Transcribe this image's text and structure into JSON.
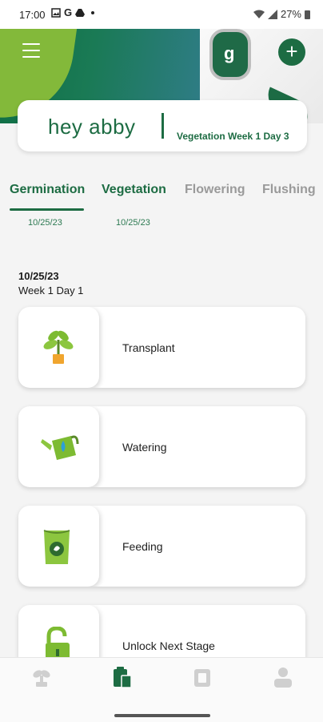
{
  "status_bar": {
    "time": "17:00",
    "g_label": "G",
    "battery": "27%"
  },
  "header": {
    "device_letter": "g",
    "add_label": "+"
  },
  "greeting": {
    "name": "hey abby",
    "stage": "Vegetation Week 1 Day 3"
  },
  "tabs": [
    {
      "label": "Germination",
      "date": "10/25/23",
      "active": true
    },
    {
      "label": "Vegetation",
      "date": "10/25/23",
      "active": false
    },
    {
      "label": "Flowering",
      "date": "",
      "active": false
    },
    {
      "label": "Flushing",
      "date": "",
      "active": false
    }
  ],
  "day": {
    "date": "10/25/23",
    "week": "Week 1 Day 1"
  },
  "tasks": [
    {
      "label": "Transplant",
      "icon": "plant-pot-icon"
    },
    {
      "label": "Watering",
      "icon": "watering-can-icon"
    },
    {
      "label": "Feeding",
      "icon": "fertilizer-bag-icon"
    },
    {
      "label": "Unlock Next Stage",
      "icon": "unlock-icon"
    }
  ],
  "bottom_nav": [
    {
      "icon": "plant-icon"
    },
    {
      "icon": "clipboard-icon"
    },
    {
      "icon": "journal-icon"
    },
    {
      "icon": "profile-icon"
    }
  ],
  "colors": {
    "brand_green": "#1d6c43",
    "leaf_green": "#83b93a",
    "inactive_tab": "#9a9a9a"
  }
}
